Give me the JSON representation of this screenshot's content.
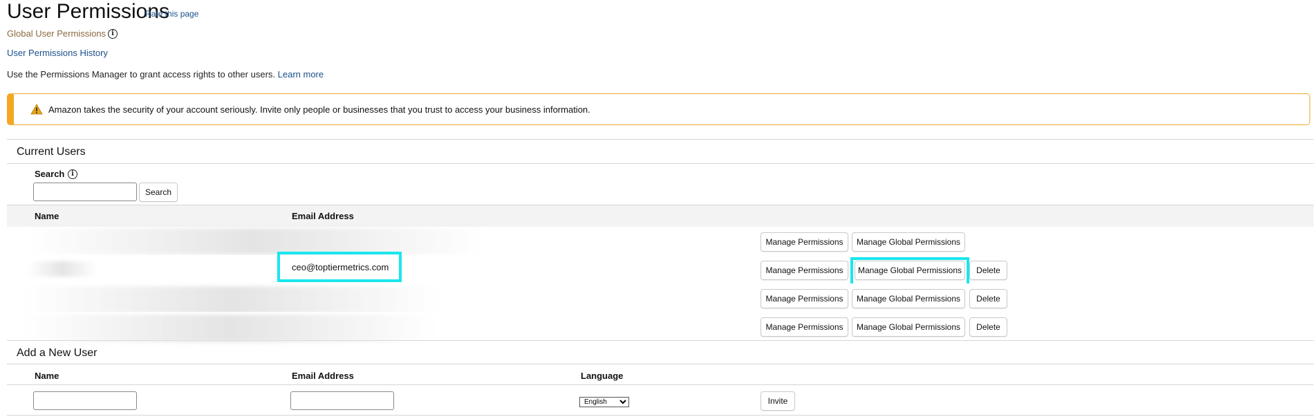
{
  "page": {
    "title": "User Permissions",
    "rate_link": "Rate this page",
    "global_user_permissions": "Global User Permissions",
    "user_permissions_history": "User Permissions History",
    "intro_text": "Use the Permissions Manager to grant access rights to other users.",
    "learn_more": "Learn more"
  },
  "alert": {
    "text": "Amazon takes the security of your account seriously. Invite only people or businesses that you trust to access your business information."
  },
  "current_users": {
    "title": "Current Users",
    "search_label": "Search",
    "search_button": "Search",
    "columns": [
      "Name",
      "Email Address"
    ],
    "rows": [
      {
        "email": "",
        "buttons": [
          "Manage Permissions",
          "Manage Global Permissions"
        ]
      },
      {
        "email": "ceo@toptiermetrics.com",
        "buttons": [
          "Manage Permissions",
          "Manage Global Permissions",
          "Delete"
        ]
      },
      {
        "email": "",
        "buttons": [
          "Manage Permissions",
          "Manage Global Permissions",
          "Delete"
        ]
      },
      {
        "email": "",
        "buttons": [
          "Manage Permissions",
          "Manage Global Permissions",
          "Delete"
        ]
      }
    ]
  },
  "add_user": {
    "title": "Add a New User",
    "name_label": "Name",
    "email_label": "Email Address",
    "language_label": "Language",
    "language_selected": "English",
    "invite_button": "Invite"
  },
  "icons": {
    "info": "info-icon",
    "warning": "warning-icon"
  },
  "colors": {
    "link": "#1a4f8a",
    "alert_border": "#f5a623",
    "highlight": "#19e6ee"
  }
}
